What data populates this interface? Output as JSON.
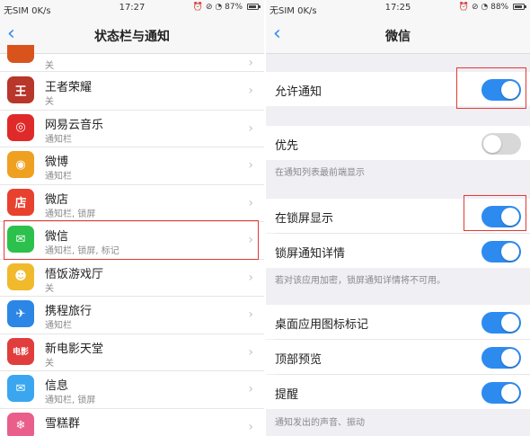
{
  "left": {
    "status_bar": {
      "carrier": "无SIM 0K/s",
      "time": "17:27",
      "battery": "87%"
    },
    "title": "状态栏与通知",
    "partial_top_sub": "关",
    "apps": [
      {
        "name": "王者荣耀",
        "sub": "关",
        "color": "#b8362a",
        "glyph": "王"
      },
      {
        "name": "网易云音乐",
        "sub": "通知栏",
        "color": "#e02a2a",
        "glyph": "◎"
      },
      {
        "name": "微博",
        "sub": "通知栏",
        "color": "#f0a020",
        "glyph": "◉"
      },
      {
        "name": "微店",
        "sub": "通知栏, 锁屏",
        "color": "#e8412e",
        "glyph": "店"
      },
      {
        "name": "微信",
        "sub": "通知栏, 锁屏, 标记",
        "color": "#2cc14d",
        "glyph": "✉"
      },
      {
        "name": "悟饭游戏厅",
        "sub": "关",
        "color": "#f1b92c",
        "glyph": "☻"
      },
      {
        "name": "携程旅行",
        "sub": "通知栏",
        "color": "#2c86e6",
        "glyph": "✈"
      },
      {
        "name": "新电影天堂",
        "sub": "关",
        "color": "#e23d3d",
        "glyph": "电影"
      },
      {
        "name": "信息",
        "sub": "通知栏, 锁屏",
        "color": "#3aa6f0",
        "glyph": "✉"
      },
      {
        "name": "雪糕群",
        "sub": "",
        "color": "#e95e8b",
        "glyph": "❄"
      }
    ]
  },
  "right": {
    "status_bar": {
      "carrier": "无SIM 0K/s",
      "time": "17:25",
      "battery": "88%"
    },
    "title": "微信",
    "settings": {
      "allow_notify": {
        "label": "允许通知",
        "on": true
      },
      "priority": {
        "label": "优先",
        "on": false,
        "note": "在通知列表最前端显示"
      },
      "lockscreen": {
        "label": "在锁屏显示",
        "on": true
      },
      "lockscreen_detail": {
        "label": "锁屏通知详情",
        "on": true,
        "note": "若对该应用加密，锁屏通知详情将不可用。"
      },
      "badge": {
        "label": "桌面应用图标标记",
        "on": true
      },
      "preview": {
        "label": "顶部预览",
        "on": true
      },
      "remind": {
        "label": "提醒",
        "on": true,
        "note": "通知发出的声音、振动"
      }
    }
  },
  "colors": {
    "accent": "#2d8bf0",
    "highlight": "#e53935"
  }
}
